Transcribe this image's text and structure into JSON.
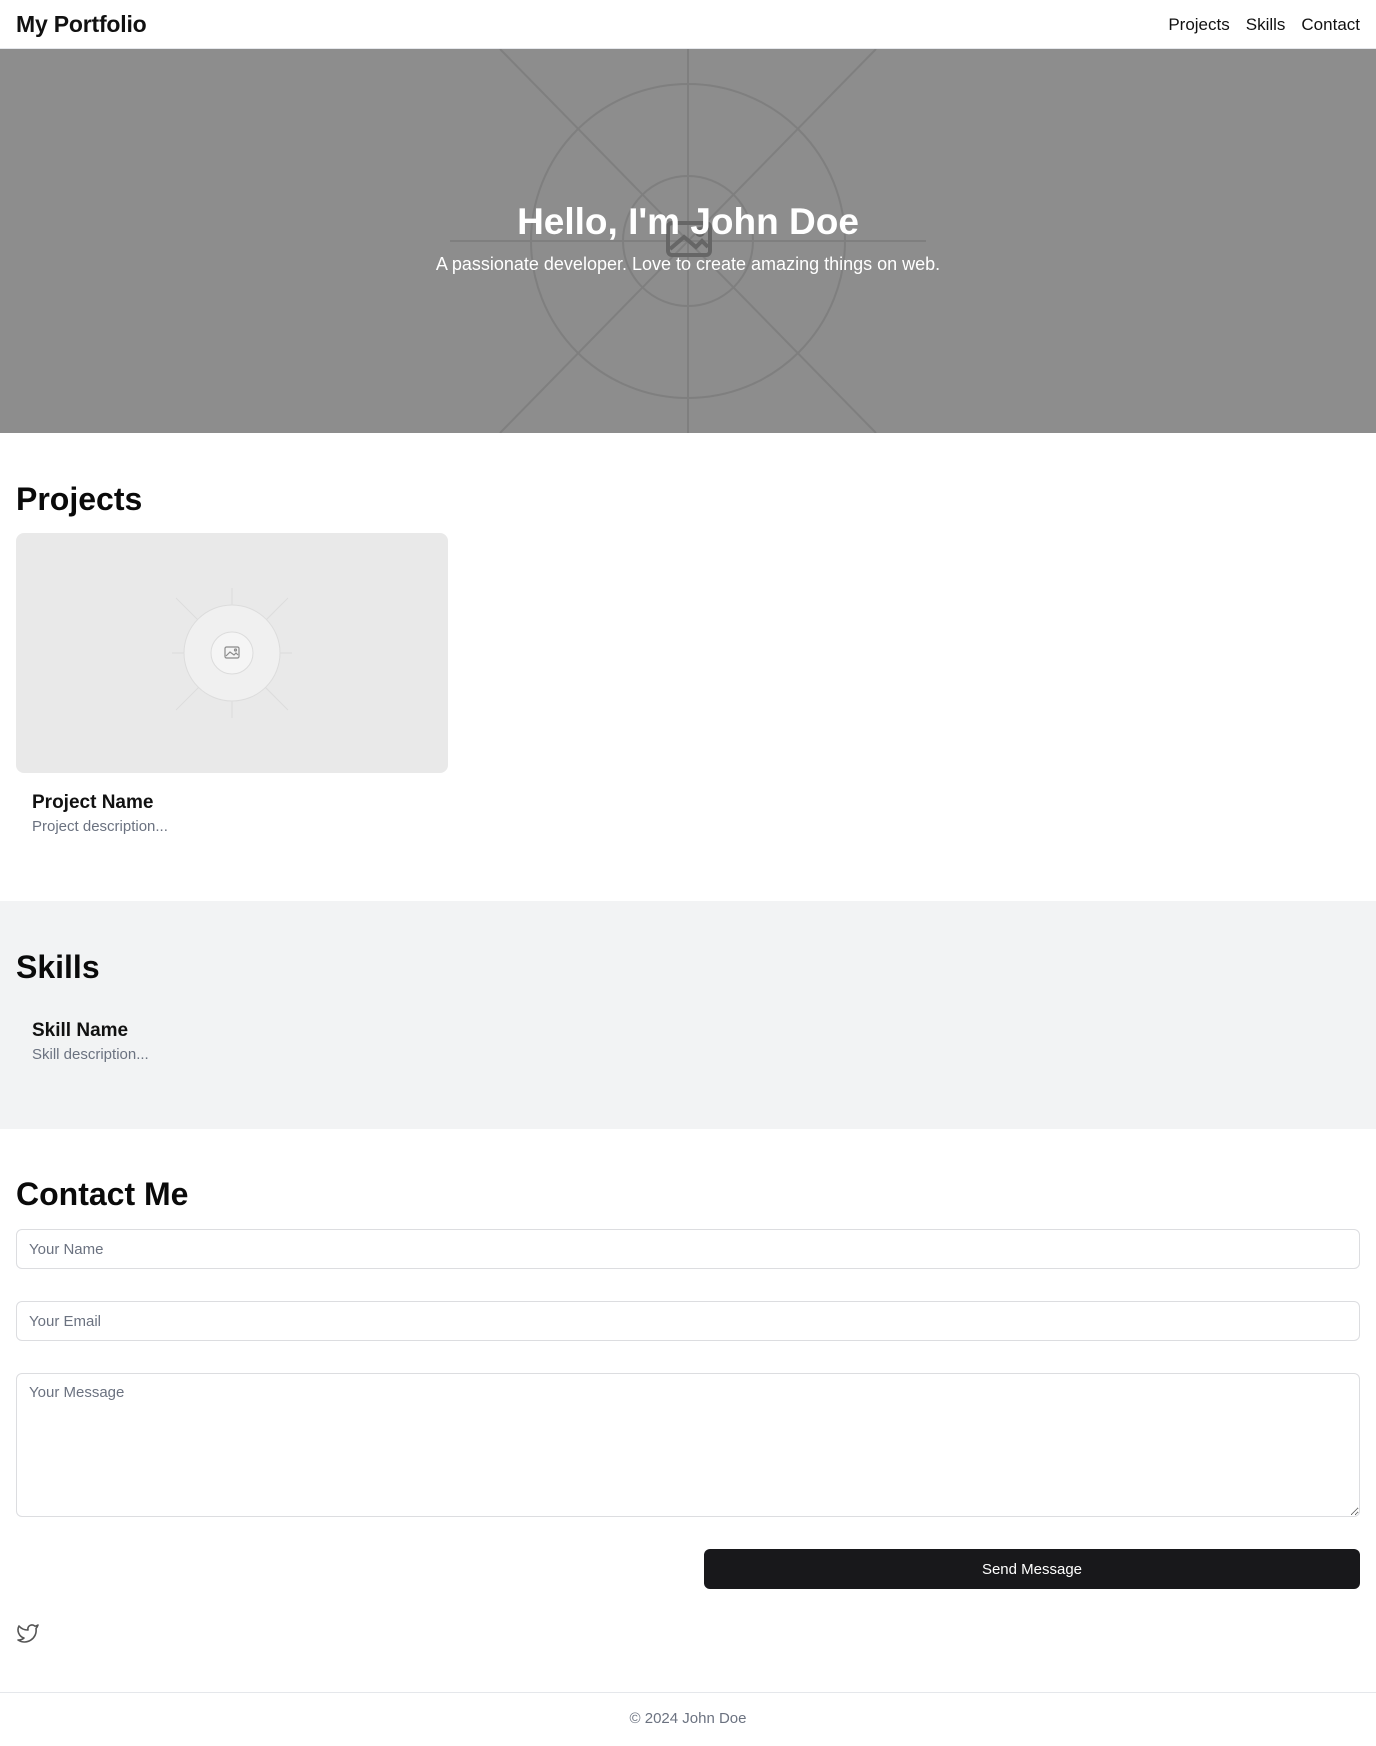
{
  "header": {
    "brand": "My Portfolio",
    "nav": [
      {
        "label": "Projects"
      },
      {
        "label": "Skills"
      },
      {
        "label": "Contact"
      }
    ]
  },
  "hero": {
    "title": "Hello, I'm John Doe",
    "subtitle": "A passionate developer. Love to create amazing things on web.",
    "background_color": "#8d8d8d",
    "icon": "image-placeholder-icon"
  },
  "projects": {
    "title": "Projects",
    "items": [
      {
        "name": "Project Name",
        "description": "Project description...",
        "image_icon": "image-placeholder-icon"
      }
    ]
  },
  "skills": {
    "title": "Skills",
    "items": [
      {
        "name": "Skill Name",
        "description": "Skill description..."
      }
    ]
  },
  "contact": {
    "title": "Contact Me",
    "name_placeholder": "Your Name",
    "email_placeholder": "Your Email",
    "message_placeholder": "Your Message",
    "send_label": "Send Message",
    "button_color": "#18181b",
    "social_icon": "twitter-icon"
  },
  "footer": {
    "copyright": "© 2024 John Doe"
  }
}
